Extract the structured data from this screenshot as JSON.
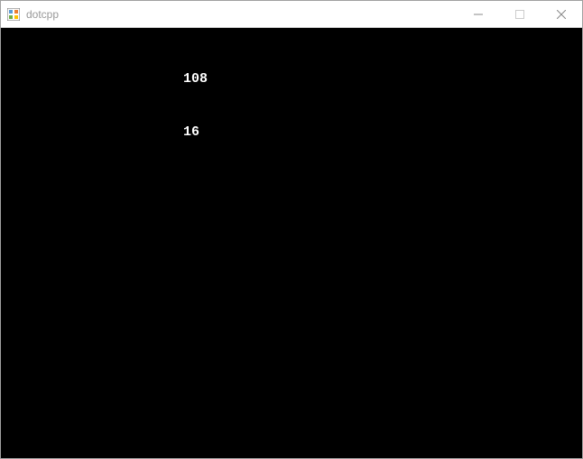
{
  "window": {
    "title": "dotcpp"
  },
  "console": {
    "lines": [
      "108",
      "16"
    ]
  }
}
